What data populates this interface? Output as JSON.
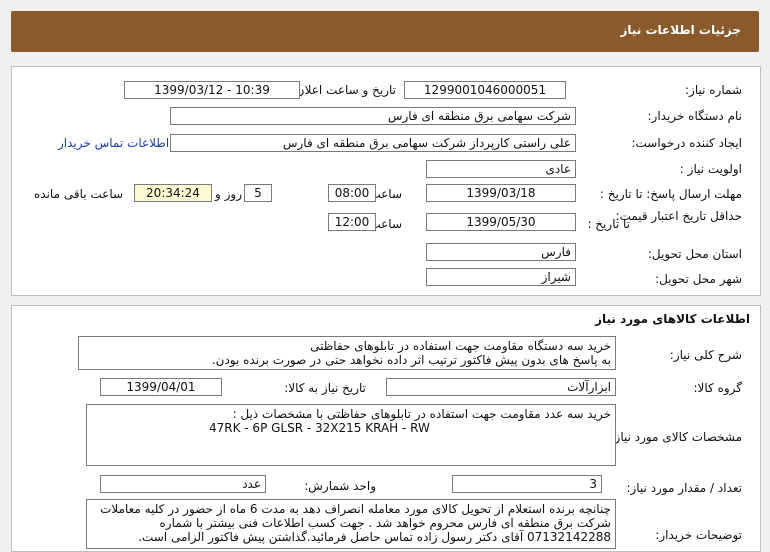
{
  "header": {
    "title": "جزئیات اطلاعات نیاز"
  },
  "need_info": {
    "need_number_label": "شماره نیاز:",
    "need_number": "1299001046000051",
    "announce_label": "تاریخ و ساعت اعلان عمومی:",
    "announce_value": "1399/03/12 - 10:39",
    "buyer_org_label": "نام دستگاه خریدار:",
    "buyer_org": "شرکت سهامی برق منطقه ای فارس",
    "requester_label": "ایجاد کننده درخواست:",
    "requester": "علی راستی کارپرداز شرکت سهامی برق منطقه ای فارس",
    "contact_link": "اطلاعات تماس خریدار",
    "priority_label": "اولویت نیاز :",
    "priority": "عادی",
    "deadline_label": "مهلت ارسال پاسخ: تا تاریخ :",
    "deadline_date": "1399/03/18",
    "time_label": "ساعت",
    "deadline_time": "08:00",
    "days_value": "5",
    "days_label": "روز و",
    "remaining_time": "20:34:24",
    "remaining_label": "ساعت باقی مانده",
    "min_valid_label": "حداقل تاریخ اعتبار قیمت:",
    "until_date_label": "تا تاریخ :",
    "min_valid_date": "1399/05/30",
    "min_valid_time_label": "ساعت",
    "min_valid_time": "12:00",
    "province_label": "استان محل تحویل:",
    "province": "فارس",
    "city_label": "شهر محل تحویل:",
    "city": "شیراز"
  },
  "goods": {
    "section_title": "اطلاعات کالاهای مورد نیاز",
    "summary_label": "شرح کلی نیاز:",
    "summary_lines": [
      "خرید سه دستگاه مقاومت جهت استفاده در تابلوهای حفاظتی",
      "به پاسخ های بدون پیش فاکتور ترتیب اثر داده نخواهد حتی در صورت برنده بودن."
    ],
    "group_label": "گروه کالا:",
    "group_value": "ابزارآلات",
    "need_date_label": "تاریخ نیاز به کالا:",
    "need_date": "1399/04/01",
    "specs_label": "مشخصات کالای مورد نیاز:",
    "specs_lines": [
      "خرید سه عدد مقاومت جهت استفاده در تابلوهای حفاظتی با مشخصات ذیل :",
      "47RK -  6P            GLSR  -  32X215          KRAH -  RW"
    ],
    "qty_label": "تعداد / مقدار مورد نیاز:",
    "qty_value": "3",
    "unit_label": "واحد شمارش:",
    "unit_value": "عدد",
    "buyer_notes_label": "توضیحات خریدار:",
    "buyer_notes_lines": [
      "چنانچه برنده استعلام از تحویل کالای مورد معامله انصراف دهد به مدت 6 ماه از حضور در کلیه معاملات",
      "شرکت برق منطقه ای فارس محروم خواهد شد . جهت کسب اطلاعات فنی بیشتر با شماره",
      "07132142288 آقای دکتر رسول زاده تماس حاصل فرمائید.گذاشتن پیش فاکتور الزامی است."
    ]
  }
}
